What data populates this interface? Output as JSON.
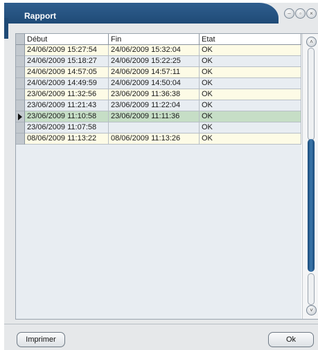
{
  "window": {
    "title": "Rapport",
    "controls": {
      "minimize": "–",
      "maximize": "▫",
      "close": "×"
    }
  },
  "grid": {
    "columns": [
      "Début",
      "Fin",
      "Etat"
    ],
    "rows": [
      {
        "debut": "24/06/2009 15:27:54",
        "fin": "24/06/2009 15:32:04",
        "etat": "OK"
      },
      {
        "debut": "24/06/2009 15:18:27",
        "fin": "24/06/2009 15:22:25",
        "etat": "OK"
      },
      {
        "debut": "24/06/2009 14:57:05",
        "fin": "24/06/2009 14:57:11",
        "etat": "OK"
      },
      {
        "debut": "24/06/2009 14:49:59",
        "fin": "24/06/2009 14:50:04",
        "etat": "OK"
      },
      {
        "debut": "23/06/2009 11:32:56",
        "fin": "23/06/2009 11:36:38",
        "etat": "OK"
      },
      {
        "debut": "23/06/2009 11:21:43",
        "fin": "23/06/2009 11:22:04",
        "etat": "OK"
      },
      {
        "debut": "23/06/2009 11:10:58",
        "fin": "23/06/2009 11:11:36",
        "etat": "OK"
      },
      {
        "debut": "23/06/2009 11:07:58",
        "fin": "",
        "etat": "OK"
      },
      {
        "debut": "08/06/2009 11:13:22",
        "fin": "08/06/2009 11:13:26",
        "etat": "OK"
      }
    ],
    "selected_row": 6
  },
  "buttons": {
    "print": "Imprimer",
    "ok": "Ok"
  },
  "scrollbar": {
    "up_glyph": "˄",
    "down_glyph": "˅"
  },
  "colors": {
    "title_bar": "#24507f",
    "row_odd": "#fdfbe6",
    "row_even": "#e8edf2",
    "row_selected": "#c6dec6",
    "scroll_thumb": "#2a5f95"
  }
}
